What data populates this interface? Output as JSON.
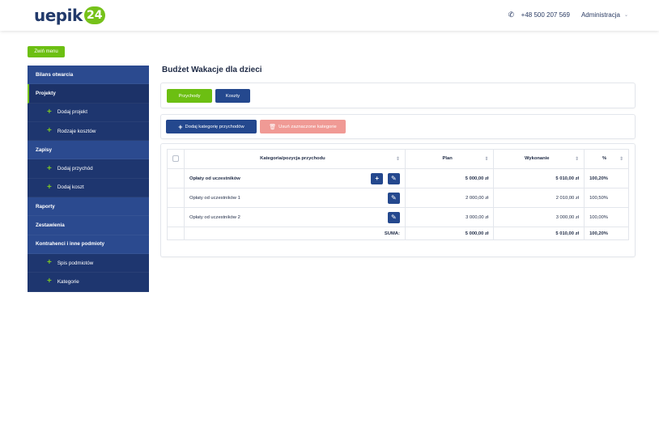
{
  "header": {
    "logo_text": "uepik",
    "logo_badge": "24",
    "phone": "+48 500 207 569",
    "user": "Administracja",
    "accent_color": "#76c21a",
    "brand_color": "#223a6b"
  },
  "collapse_label": "Zwiń menu",
  "sidebar": {
    "items": [
      {
        "label": "Bilans otwarcia",
        "type": "parent"
      },
      {
        "label": "Projekty",
        "type": "active"
      },
      {
        "label": "Dodaj projekt",
        "type": "sub"
      },
      {
        "label": "Rodzaje kosztów",
        "type": "sub"
      },
      {
        "label": "Zapisy",
        "type": "parent"
      },
      {
        "label": "Dodaj przychód",
        "type": "sub"
      },
      {
        "label": "Dodaj koszt",
        "type": "sub"
      },
      {
        "label": "Raporty",
        "type": "parent"
      },
      {
        "label": "Zestawienia",
        "type": "parent"
      },
      {
        "label": "Kontrahenci i inne podmioty",
        "type": "parent"
      },
      {
        "label": "Spis podmiotów",
        "type": "sub"
      },
      {
        "label": "Kategorie",
        "type": "sub"
      }
    ]
  },
  "main": {
    "title": "Budżet Wakacje dla dzieci",
    "tabs": {
      "income": "Przychody",
      "costs": "Koszty"
    },
    "actions": {
      "add_category": "Dodaj kategorię przychodów",
      "delete_selected": "Usuń zaznaczone kategorie"
    },
    "table": {
      "headers": {
        "category": "Kategoria/pozycja przychodu",
        "plan": "Plan",
        "execution": "Wykonanie",
        "percent": "%"
      },
      "rows": [
        {
          "name": "Opłaty od uczestników",
          "plan": "5 000,00 zł",
          "execution": "5 010,00 zł",
          "percent": "100,20%"
        },
        {
          "name": "Opłaty od uczestników 1",
          "plan": "2 000,00 zł",
          "execution": "2 010,00 zł",
          "percent": "100,50%"
        },
        {
          "name": "Opłaty od uczestników 2",
          "plan": "3 000,00 zł",
          "execution": "3 000,00 zł",
          "percent": "100,00%"
        }
      ],
      "sum": {
        "label": "SUMA:",
        "plan": "5 000,00 zł",
        "execution": "5 010,00 zł",
        "percent": "100,20%"
      }
    }
  }
}
